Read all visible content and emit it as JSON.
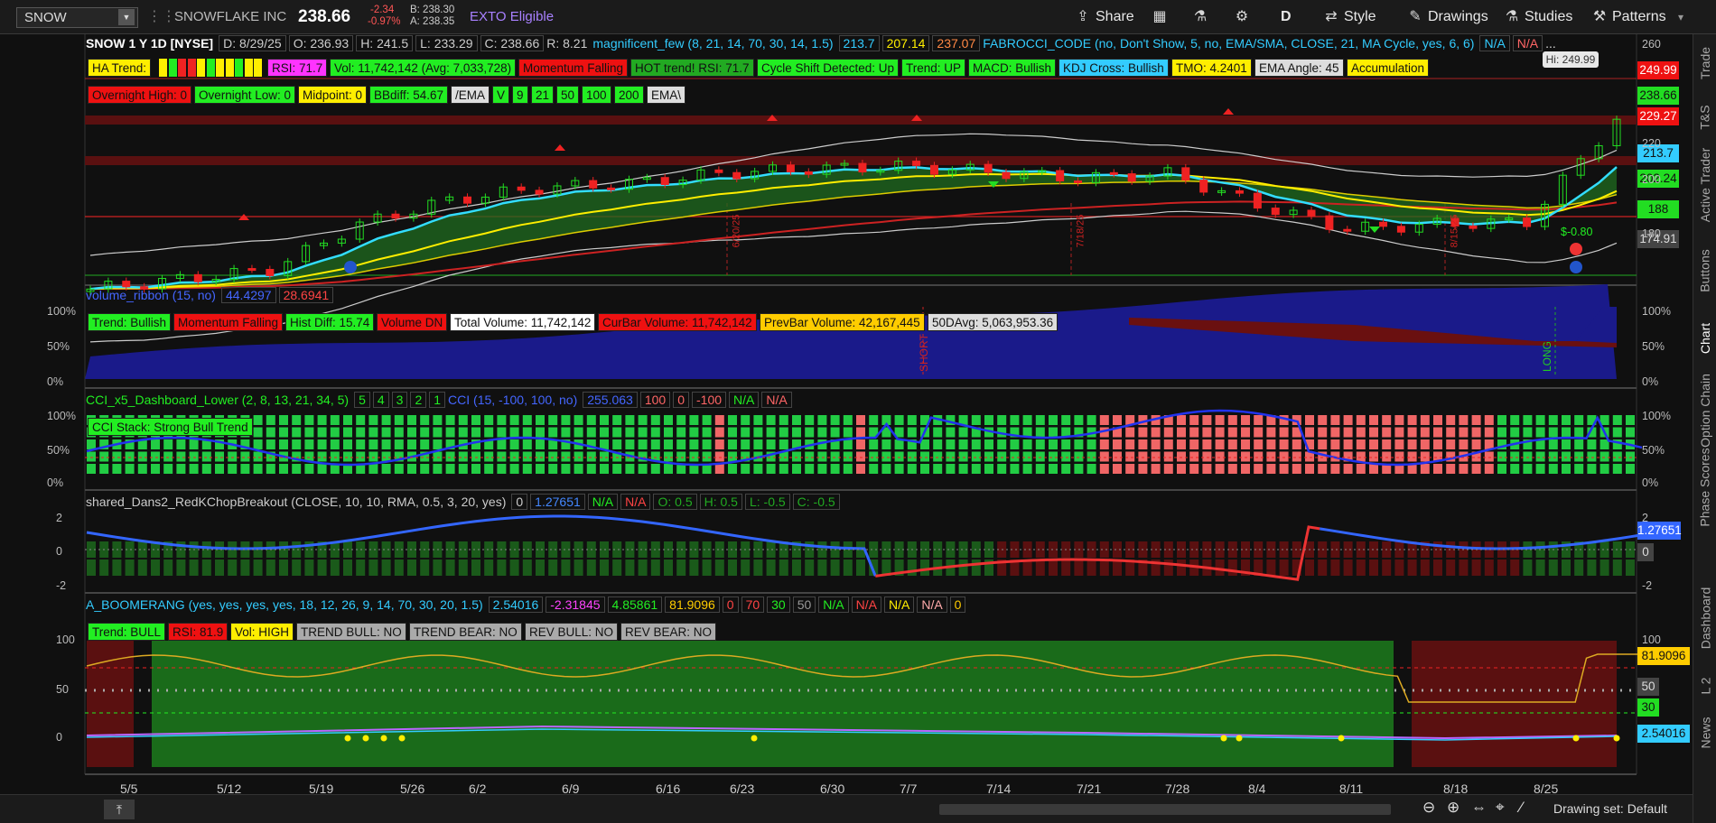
{
  "topbar": {
    "symbol": "SNOW",
    "company": "SNOWFLAKE INC",
    "price": "238.66",
    "change": "-2.34",
    "change_pct": "-0.97%",
    "bid": "B: 238.30",
    "ask": "A: 238.35",
    "exto": "EXTO Eligible",
    "share": "Share",
    "period": "D",
    "style": "Style",
    "drawings": "Drawings",
    "studies": "Studies",
    "patterns": "Patterns"
  },
  "price_panel": {
    "header": {
      "symbol_desc": "SNOW 1 Y 1D [NYSE]",
      "date": "D: 8/29/25",
      "open": "O: 236.93",
      "high": "H: 241.5",
      "low": "L: 233.29",
      "close": "C: 238.66",
      "range": "R: 8.21",
      "study": "magnificent_few (8, 21, 14, 70, 30, 14, 1.5)",
      "v1": "213.7",
      "v2": "207.14",
      "v3": "237.07",
      "study2": "FABROCCI_CODE (no, Don't Show, 5, no, EMA/SMA, CLOSE, 21, MA Cycle, yes, 6, 6)",
      "na1": "N/A",
      "na2": "N/A",
      "ellipsis": "..."
    },
    "row1": [
      {
        "t": "HA Trend:",
        "bg": "#ffee00",
        "fg": "#111"
      },
      {
        "t": "RSI: 71.7",
        "bg": "#ff33ff",
        "fg": "#111"
      },
      {
        "t": "Vol: 11,742,142 (Avg: 7,033,728)",
        "bg": "#22ee22",
        "fg": "#111"
      },
      {
        "t": "Momentum Falling",
        "bg": "#ee1111",
        "fg": "#111"
      },
      {
        "t": "HOT trend!  RSI: 71.7",
        "bg": "#22aa22",
        "fg": "#111"
      },
      {
        "t": "Cycle Shift Detected: Up",
        "bg": "#22ee22",
        "fg": "#111"
      },
      {
        "t": "Trend: UP",
        "bg": "#22ee22",
        "fg": "#111"
      },
      {
        "t": "MACD: Bullish",
        "bg": "#22ee22",
        "fg": "#111"
      },
      {
        "t": "KDJ Cross: Bullish",
        "bg": "#33ccff",
        "fg": "#111"
      },
      {
        "t": "TMO: 4.2401",
        "bg": "#ffee00",
        "fg": "#111"
      },
      {
        "t": "EMA Angle: 45",
        "bg": "#dddddd",
        "fg": "#111"
      },
      {
        "t": "Accumulation",
        "bg": "#ffee00",
        "fg": "#111"
      }
    ],
    "row2": [
      {
        "t": "Overnight High: 0",
        "bg": "#ee1111",
        "fg": "#111"
      },
      {
        "t": "Overnight Low: 0",
        "bg": "#22ee22",
        "fg": "#111"
      },
      {
        "t": "Midpoint: 0",
        "bg": "#ffee00",
        "fg": "#111"
      },
      {
        "t": "BBdiff: 54.67",
        "bg": "#22ee22",
        "fg": "#111"
      },
      {
        "t": "/EMA",
        "bg": "#dddddd",
        "fg": "#111"
      },
      {
        "t": "V",
        "bg": "#22ee22",
        "fg": "#111"
      },
      {
        "t": "9",
        "bg": "#22ee22",
        "fg": "#111"
      },
      {
        "t": "21",
        "bg": "#22ee22",
        "fg": "#111"
      },
      {
        "t": "50",
        "bg": "#22ee22",
        "fg": "#111"
      },
      {
        "t": "100",
        "bg": "#22ee22",
        "fg": "#111"
      },
      {
        "t": "200",
        "bg": "#22ee22",
        "fg": "#111"
      },
      {
        "t": "EMA\\",
        "bg": "#dddddd",
        "fg": "#111"
      }
    ],
    "high_bubble": "Hi: 249.99",
    "scale_labels": [
      {
        "t": "249.99",
        "bg": "#ee1111",
        "fg": "#fff"
      },
      {
        "t": "238.66",
        "bg": "#22dd22",
        "fg": "#111"
      },
      {
        "t": "229.27",
        "bg": "#ee1111",
        "fg": "#fff"
      },
      {
        "t": "213.7",
        "bg": "#33ccff",
        "fg": "#111"
      },
      {
        "t": "202.24",
        "bg": "#22dd22",
        "fg": "#111"
      },
      {
        "t": "188",
        "bg": "#22dd22",
        "fg": "#111"
      },
      {
        "t": "174.91",
        "bg": "#444444",
        "fg": "#ddd"
      }
    ],
    "axis_ticks": [
      "260",
      "220",
      "200",
      "180"
    ],
    "vlines": [
      "6/20/25",
      "7/18/25",
      "8/15/25"
    ],
    "pl_text": "$-0.80"
  },
  "volume_panel": {
    "header": {
      "name": "volume_ribbon (15, no)",
      "v1": "44.4297",
      "v2": "28.6941"
    },
    "labels": [
      {
        "t": "Trend: Bullish",
        "bg": "#22ee22",
        "fg": "#111"
      },
      {
        "t": "Momentum Falling",
        "bg": "#ee1111",
        "fg": "#111"
      },
      {
        "t": "Hist Diff: 15.74",
        "bg": "#22ee22",
        "fg": "#111"
      },
      {
        "t": "Volume DN",
        "bg": "#ee1111",
        "fg": "#111"
      },
      {
        "t": "Total Volume: 11,742,142",
        "bg": "#ffffff",
        "fg": "#111"
      },
      {
        "t": "CurBar Volume: 11,742,142",
        "bg": "#ee1111",
        "fg": "#111"
      },
      {
        "t": "PrevBar Volume: 42,167,445",
        "bg": "#ffcc00",
        "fg": "#111"
      },
      {
        "t": "50DAvg: 5,063,953.36",
        "bg": "#dddddd",
        "fg": "#111"
      }
    ],
    "scale": [
      "100%",
      "50%",
      "0%"
    ],
    "short": "SHORT",
    "long": "LONG"
  },
  "cci_panel": {
    "header": {
      "name": "CCI_x5_Dashboard_Lower (2, 8, 13, 21, 34, 5)",
      "v": [
        "5",
        "4",
        "3",
        "2",
        "1"
      ],
      "cci": "CCI (15, -100, 100, no)",
      "cci_v": "255.063",
      "a": "100",
      "b": "0",
      "c": "-100",
      "na1": "N/A",
      "na2": "N/A"
    },
    "stack": "CCI Stack: Strong Bull Trend",
    "scale": [
      "100%",
      "50%",
      "0%"
    ]
  },
  "rk_panel": {
    "header": {
      "name": "shared_Dans2_RedKChopBreakout (CLOSE, 10, 10, RMA, 0.5, 3, 20, yes)",
      "v0": "0",
      "v1": "1.27651",
      "na1": "N/A",
      "na2": "N/A",
      "o": "O: 0.5",
      "h": "H: 0.5",
      "l": "L: -0.5",
      "c": "C: -0.5"
    },
    "scale": [
      "2",
      "0",
      "-2"
    ],
    "labels": [
      {
        "t": "1.27651",
        "bg": "#3366ff",
        "fg": "#fff"
      },
      {
        "t": "0",
        "bg": "#444444",
        "fg": "#ddd"
      }
    ]
  },
  "boom_panel": {
    "header": {
      "name": "A_BOOMERANG (yes, yes, yes, yes, 18, 12, 26, 9, 14, 70, 30, 20, 1.5)",
      "v1": "2.54016",
      "v2": "-2.31845",
      "v3": "4.85861",
      "v4": "81.9096",
      "v5": "0",
      "v6": "70",
      "v7": "30",
      "v8": "50",
      "na": [
        "N/A",
        "N/A",
        "N/A",
        "N/A"
      ],
      "z": "0"
    },
    "labels": [
      {
        "t": "Trend: BULL",
        "bg": "#22ee22",
        "fg": "#111"
      },
      {
        "t": "RSI: 81.9",
        "bg": "#ee1111",
        "fg": "#111"
      },
      {
        "t": "Vol: HIGH",
        "bg": "#ffee00",
        "fg": "#111"
      },
      {
        "t": "TREND BULL: NO",
        "bg": "#aaaaaa",
        "fg": "#111"
      },
      {
        "t": "TREND BEAR: NO",
        "bg": "#aaaaaa",
        "fg": "#111"
      },
      {
        "t": "REV BULL: NO",
        "bg": "#aaaaaa",
        "fg": "#111"
      },
      {
        "t": "REV BEAR: NO",
        "bg": "#aaaaaa",
        "fg": "#111"
      }
    ],
    "scale": [
      "100",
      "50",
      "0"
    ],
    "right_labels": [
      {
        "t": "81.9096",
        "bg": "#ffcc00",
        "fg": "#111"
      },
      {
        "t": "50",
        "bg": "#444444",
        "fg": "#ddd"
      },
      {
        "t": "30",
        "bg": "#22dd22",
        "fg": "#111"
      },
      {
        "t": "2.54016",
        "bg": "#33ccff",
        "fg": "#111"
      }
    ]
  },
  "dates": [
    "5/5",
    "5/12",
    "5/19",
    "5/26",
    "6/2",
    "6/9",
    "6/16",
    "6/23",
    "6/30",
    "7/7",
    "7/14",
    "7/21",
    "7/28",
    "8/4",
    "8/11",
    "8/18",
    "8/25"
  ],
  "right_tabs": [
    "Trade",
    "T&S",
    "Active Trader",
    "Buttons",
    "Chart",
    "Option Chain",
    "Phase Scores",
    "Dashboard",
    "L 2",
    "News"
  ],
  "bottom": {
    "drawing_set": "Drawing set: Default"
  },
  "chart_data": {
    "type": "line",
    "title": "SNOW 1 Y 1D [NYSE]",
    "ylim": [
      170,
      262
    ],
    "x": [
      "5/5",
      "5/12",
      "5/19",
      "5/26",
      "6/2",
      "6/9",
      "6/16",
      "6/23",
      "6/30",
      "7/7",
      "7/14",
      "7/21",
      "7/28",
      "8/4",
      "8/11",
      "8/18",
      "8/25",
      "8/29"
    ],
    "series": [
      {
        "values": [
          168,
          172,
          176,
          195,
          205,
          210,
          212,
          216,
          218,
          219,
          217,
          214,
          216,
          203,
          193,
          195,
          196,
          238.66
        ]
      }
    ],
    "colors": {
      "up": "#22dd22",
      "down": "#ee2222",
      "ema1": "#33ddff",
      "ema2": "#ffee00",
      "ema3": "#22ee22",
      "ema4": "#ee2222",
      "bb": "#cccccc"
    }
  }
}
